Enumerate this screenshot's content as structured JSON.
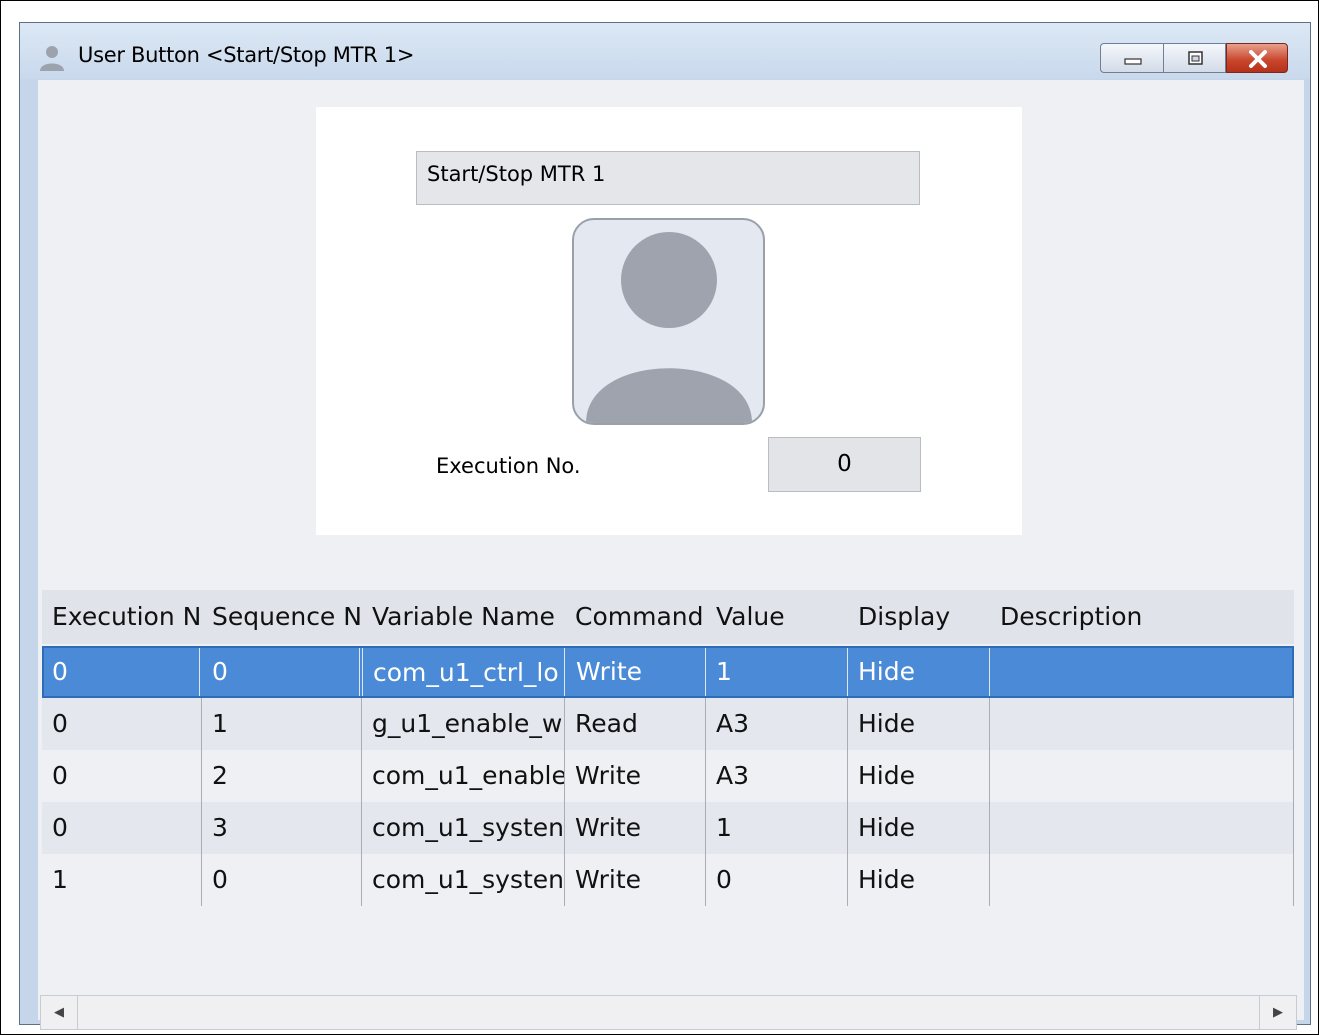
{
  "window": {
    "title": "User Button <Start/Stop MTR 1>",
    "icon": "user-icon",
    "controls": [
      "minimize-icon",
      "maximize-icon",
      "close-icon"
    ]
  },
  "preview": {
    "button_name": "Start/Stop MTR 1",
    "image_icon": "person-placeholder-icon",
    "execution_label": "Execution No.",
    "execution_value": "0"
  },
  "table": {
    "columns": [
      "Execution N",
      "Sequence N",
      "Variable Name",
      "Command",
      "Value",
      "Display",
      "Description"
    ],
    "rows": [
      [
        "0",
        "0",
        "com_u1_ctrl_lo",
        "Write",
        "1",
        "Hide",
        ""
      ],
      [
        "0",
        "1",
        "g_u1_enable_w",
        "Read",
        "A3",
        "Hide",
        ""
      ],
      [
        "0",
        "2",
        "com_u1_enable",
        "Write",
        "A3",
        "Hide",
        ""
      ],
      [
        "0",
        "3",
        "com_u1_systen",
        "Write",
        "1",
        "Hide",
        ""
      ],
      [
        "1",
        "0",
        "com_u1_systen",
        "Write",
        "0",
        "Hide",
        ""
      ]
    ],
    "selected_row": 0
  },
  "scrollbar": {
    "left_arrow": "◀",
    "right_arrow": "▶"
  },
  "colors": {
    "selection": "#4a8ad6",
    "title_bar": "#c9d9ec",
    "close_button": "#c8442a"
  }
}
